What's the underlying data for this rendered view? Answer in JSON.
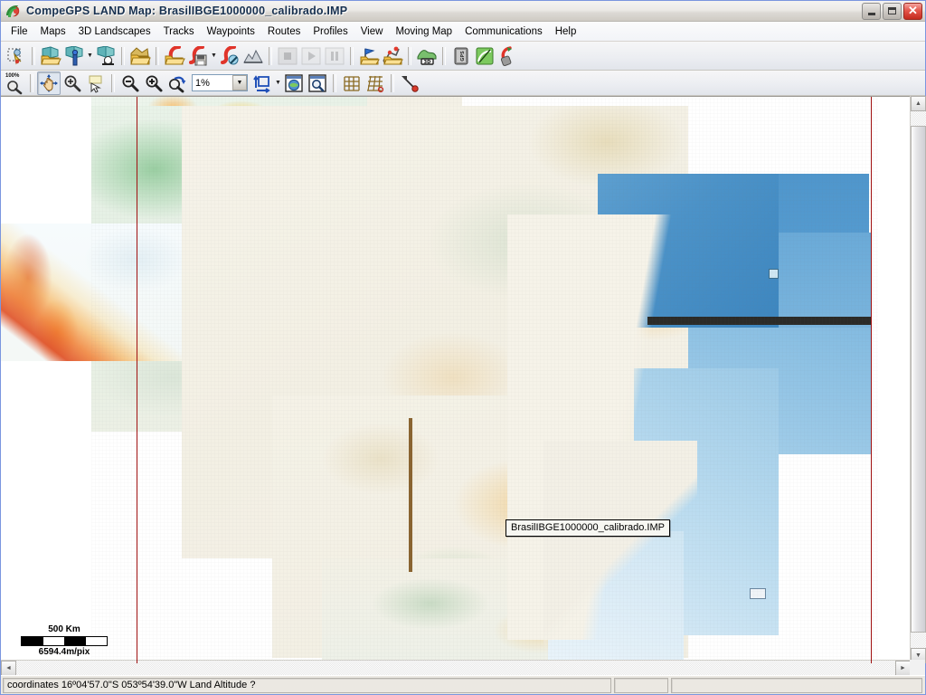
{
  "window": {
    "title": "CompeGPS LAND Map: BrasilIBGE1000000_calibrado.IMP",
    "app_icon": "compegps-logo-icon",
    "buttons": {
      "minimize": "Minimize",
      "maximize": "Maximize",
      "close": "Close"
    }
  },
  "menubar": {
    "items": [
      {
        "label": "File",
        "name": "menu-file"
      },
      {
        "label": "Maps",
        "name": "menu-maps"
      },
      {
        "label": "3D Landscapes",
        "name": "menu-3d-landscapes"
      },
      {
        "label": "Tracks",
        "name": "menu-tracks"
      },
      {
        "label": "Waypoints",
        "name": "menu-waypoints"
      },
      {
        "label": "Routes",
        "name": "menu-routes"
      },
      {
        "label": "Profiles",
        "name": "menu-profiles"
      },
      {
        "label": "View",
        "name": "menu-view"
      },
      {
        "label": "Moving Map",
        "name": "menu-moving-map"
      },
      {
        "label": "Communications",
        "name": "menu-communications"
      },
      {
        "label": "Help",
        "name": "menu-help"
      }
    ]
  },
  "toolbar_main": {
    "items": [
      {
        "name": "select-objects-button",
        "icon": "select-pointer-icon",
        "title": "Select"
      },
      {
        "name": "separator-1",
        "icon": "separator"
      },
      {
        "name": "open-map-button",
        "icon": "open-map-folder-icon",
        "title": "Open Map"
      },
      {
        "name": "open-map-by-point-button",
        "icon": "open-map-point-icon",
        "title": "Open map by point"
      },
      {
        "name": "open-map-dropdown",
        "icon": "chevron-down-icon"
      },
      {
        "name": "close-map-button",
        "icon": "close-map-icon",
        "title": "Close Map"
      },
      {
        "name": "separator-2",
        "icon": "separator"
      },
      {
        "name": "open-3d-landscape-button",
        "icon": "relief-folder-icon",
        "title": "Open 3D Landscape"
      },
      {
        "name": "separator-3",
        "icon": "separator"
      },
      {
        "name": "open-track-button",
        "icon": "open-track-folder-icon",
        "title": "Open Track"
      },
      {
        "name": "save-track-button",
        "icon": "save-track-icon",
        "title": "Save Track"
      },
      {
        "name": "save-track-dropdown",
        "icon": "chevron-down-icon"
      },
      {
        "name": "close-track-button",
        "icon": "close-track-icon",
        "title": "Close Track"
      },
      {
        "name": "track-profile-button",
        "icon": "profile-graph-icon",
        "title": "Track profile"
      },
      {
        "name": "separator-4",
        "icon": "separator"
      },
      {
        "name": "stop-button",
        "icon": "stop-square-icon",
        "title": "Stop"
      },
      {
        "name": "play-button",
        "icon": "play-triangle-icon",
        "title": "Play"
      },
      {
        "name": "pause-button",
        "icon": "pause-bars-icon",
        "title": "Pause"
      },
      {
        "name": "separator-5",
        "icon": "separator"
      },
      {
        "name": "open-waypoints-button",
        "icon": "waypoint-flag-folder-icon",
        "title": "Open Waypoints"
      },
      {
        "name": "open-routes-button",
        "icon": "route-folder-icon",
        "title": "Open Routes"
      },
      {
        "name": "separator-6",
        "icon": "separator"
      },
      {
        "name": "view-3d-button",
        "icon": "3d-relief-icon",
        "title": "3D View"
      },
      {
        "name": "separator-7",
        "icon": "separator"
      },
      {
        "name": "gps-device-button",
        "icon": "gps-device-icon",
        "title": "GPS device"
      },
      {
        "name": "satellite-status-button",
        "icon": "satellite-dish-icon",
        "title": "Satellite status"
      },
      {
        "name": "moving-map-button",
        "icon": "moving-map-gps-icon",
        "title": "Moving map"
      }
    ]
  },
  "toolbar_view": {
    "zoom_value": "1%",
    "items": [
      {
        "name": "zoom-100-button",
        "icon": "zoom-100-percent-icon",
        "title": "100%",
        "badge": "100%"
      },
      {
        "name": "separator-1",
        "icon": "separator"
      },
      {
        "name": "pan-hand-button",
        "icon": "pan-hand-icon",
        "title": "Pan",
        "state": "pressed"
      },
      {
        "name": "zoom-window-button",
        "icon": "zoom-window-icon",
        "title": "Zoom to window"
      },
      {
        "name": "select-pointer-button",
        "icon": "arrow-pointer-icon",
        "title": "Pointer"
      },
      {
        "name": "separator-2",
        "icon": "separator"
      },
      {
        "name": "zoom-out-button",
        "icon": "zoom-out-icon",
        "title": "Zoom out"
      },
      {
        "name": "zoom-in-button",
        "icon": "zoom-in-icon",
        "title": "Zoom in"
      },
      {
        "name": "zoom-refresh-button",
        "icon": "zoom-refresh-icon",
        "title": "Refresh zoom"
      },
      {
        "name": "zoom-level-combo",
        "icon": "combobox"
      },
      {
        "name": "fit-window-button",
        "icon": "fit-to-window-icon",
        "title": "Fit to window"
      },
      {
        "name": "fit-window-dropdown",
        "icon": "chevron-down-icon"
      },
      {
        "name": "map-globe-button",
        "icon": "globe-map-icon",
        "title": "World map"
      },
      {
        "name": "map-magnify-button",
        "icon": "magnify-map-icon",
        "title": "Map detail"
      },
      {
        "name": "separator-3",
        "icon": "separator"
      },
      {
        "name": "grid-button",
        "icon": "grid-icon",
        "title": "Grid"
      },
      {
        "name": "grid-projection-button",
        "icon": "grid-projection-icon",
        "title": "Grid projection"
      },
      {
        "name": "separator-4",
        "icon": "separator"
      },
      {
        "name": "measure-distance-button",
        "icon": "measure-distance-icon",
        "title": "Measure distance"
      }
    ]
  },
  "map": {
    "tooltip_label": "BrasilIBGE1000000_calibrado.IMP",
    "scale": {
      "distance_label": "500 Km",
      "resolution_label": "6594.4m/pix"
    },
    "boundary_line_color": "#9f1010"
  },
  "scrollbars": {
    "vertical": {
      "up": "▲",
      "down": "▼"
    },
    "horizontal": {
      "left": "◄",
      "right": "►"
    }
  },
  "statusbar": {
    "coordinates_text": "coordinates 16º04'57.0\"S 053º54'39.0\"W Land Altitude ?",
    "pane2_text": "",
    "pane3_text": ""
  }
}
